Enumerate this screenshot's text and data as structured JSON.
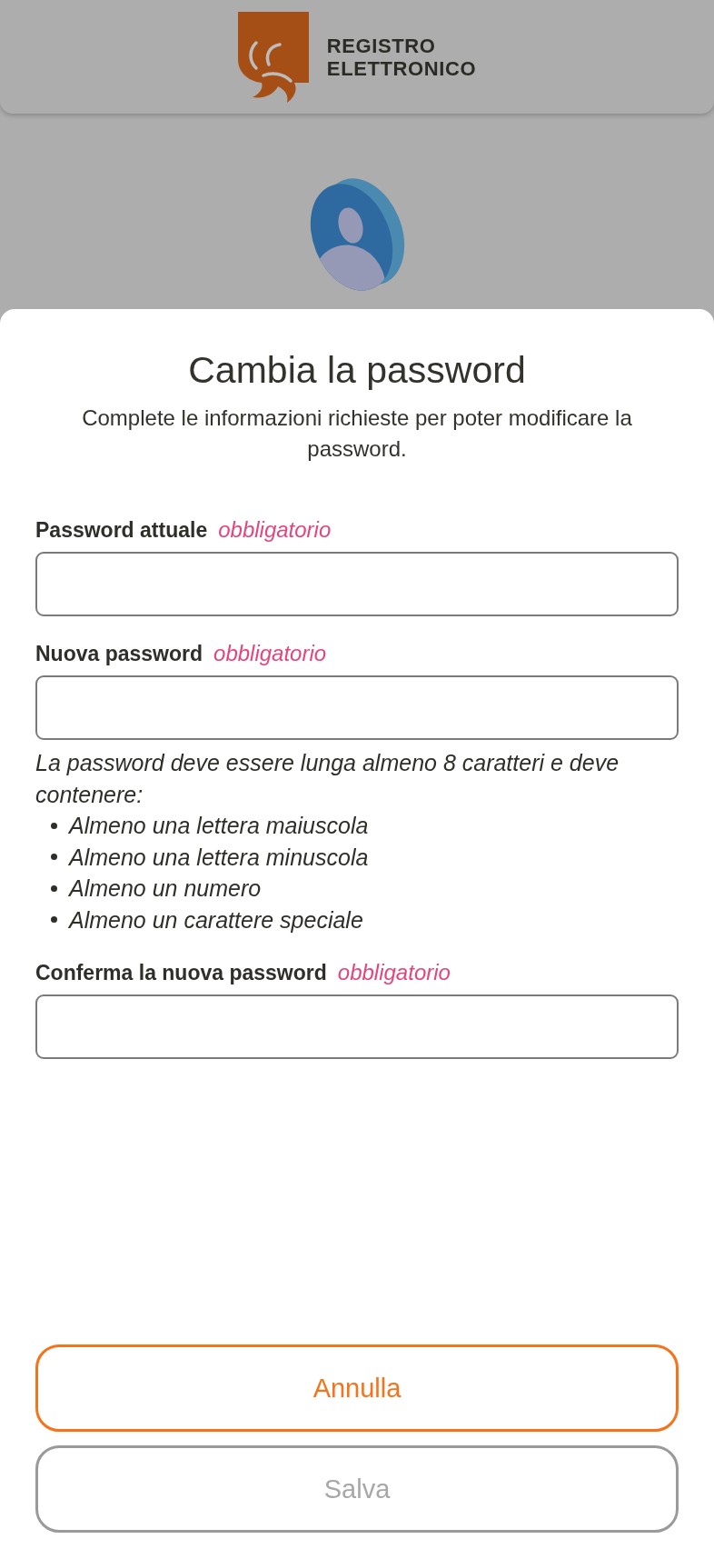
{
  "header": {
    "logo_lines": [
      "REGISTRO",
      "ELETTRONICO"
    ]
  },
  "sheet": {
    "title": "Cambia la password",
    "subtitle": "Complete le informazioni richieste per poter modificare la password.",
    "fields": [
      {
        "label": "Password attuale",
        "required_note": "obbligatorio"
      },
      {
        "label": "Nuova password",
        "required_note": "obbligatorio",
        "hint": {
          "text": "La password deve essere lunga almeno 8 caratteri e deve contenere:",
          "items": [
            "Almeno una lettera maiuscola",
            "Almeno una lettera minuscola",
            "Almeno un numero",
            "Almeno un carattere speciale"
          ]
        }
      },
      {
        "label": "Conferma la nuova password",
        "required_note": "obbligatorio"
      }
    ],
    "buttons": [
      {
        "label": "Annulla",
        "disabled": false
      },
      {
        "label": "Salva",
        "disabled": true
      }
    ]
  }
}
